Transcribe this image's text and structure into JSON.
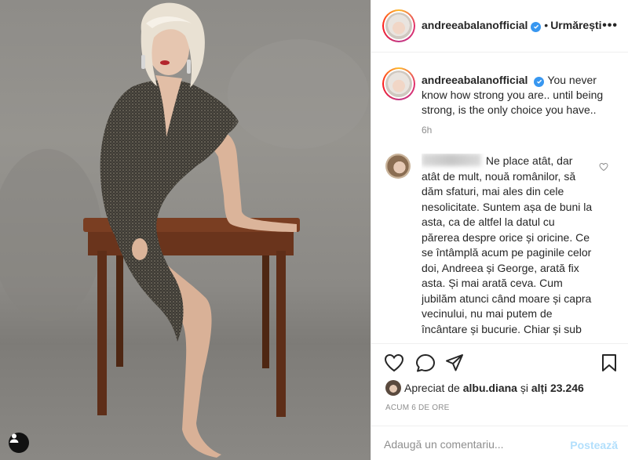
{
  "post": {
    "username": "andreeabalanofficial",
    "verified": true,
    "follow_label": "Urmărești",
    "more_icon": "•••",
    "caption": "You never know how strong you are.. until being strong, is the only choice you have..",
    "time": "6h",
    "comment": {
      "username_hidden": true,
      "text": "Ne place atât, dar atât de mult, nouă românilor, să dăm sfaturi, mai ales din cele nesolicitate. Suntem așa de buni la asta, ca de altfel la datul cu părerea despre orice și oricine. Ce se întâmplă acum pe paginile celor doi, Andreea și George, arată fix asta. Și mai arată ceva. Cum jubilăm atunci când moare și capra vecinului, nu mai putem de încântare și bucurie. Chiar și sub aparența mască a compătimirii și bunăvoinței, se ascunde aceeași răutate."
    },
    "likes": {
      "prefix": "Apreciat de",
      "user": "albu.diana",
      "conj": "și",
      "others": "alți 23.246"
    },
    "ago": "ACUM 6 DE ORE",
    "add_comment_placeholder": "Adaugă un comentariu...",
    "post_label": "Postează"
  },
  "icons": {
    "like": "heart-icon",
    "comment": "comment-icon",
    "share": "paper-plane-icon",
    "save": "bookmark-icon",
    "tag": "person-tag-icon",
    "verified": "verified-badge-icon",
    "comment_like": "heart-outline-icon"
  },
  "colors": {
    "verified": "#3897f0",
    "post_button_disabled": "#b2dffc",
    "muted": "#8e8e8e",
    "text": "#262626"
  }
}
